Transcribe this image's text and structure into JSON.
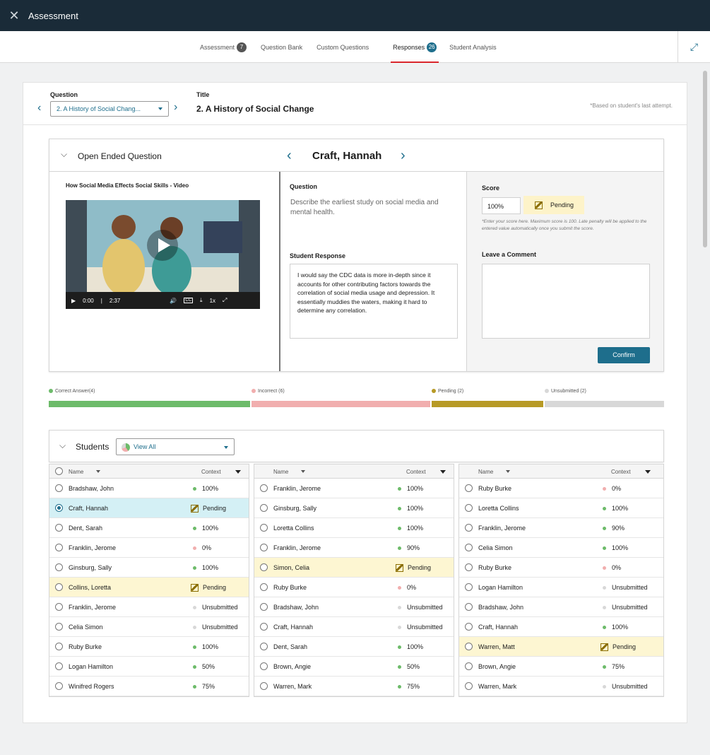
{
  "app": {
    "title": "Assessment",
    "close_icon": "close-icon"
  },
  "tabs": [
    {
      "label": "Assessment",
      "count": "7"
    },
    {
      "label": "Question Bank",
      "count": ""
    },
    {
      "label": "Custom Questions",
      "count": ""
    },
    {
      "label": "Responses",
      "count": "26",
      "active": true
    },
    {
      "label": "Student Analysis",
      "count": ""
    }
  ],
  "question": {
    "label": "Question",
    "selected": "2. A History of Social Chang...",
    "title_label": "Title",
    "title": "2. A History of Social Change",
    "note": "*Based on student's last attempt."
  },
  "open_ended": {
    "label": "Open Ended Question",
    "student": "Craft, Hannah"
  },
  "media": {
    "title": "How Social Media Effects Social Skills - Video",
    "time": "0:00",
    "duration": "2:37",
    "speed": "1x"
  },
  "prompt": {
    "label": "Question",
    "text": "Describe the earliest study on social media and mental health.",
    "response_label": "Student Response",
    "response": "I would say the CDC data is more in-depth since it accounts for other contributing factors towards the correlation of social media usage and depression. It essentially muddies the waters, making it hard to determine any correlation."
  },
  "score": {
    "label": "Score",
    "value": "100%",
    "status": "Pending",
    "hint": "*Enter your score here. Maximum score is 100. Late penalty will be applied to the entered value automatically once you submit the score.",
    "comment_label": "Leave a Comment",
    "confirm": "Confirm"
  },
  "progress": [
    {
      "label": "Correct Answer(4)",
      "color": "#6dbb6a"
    },
    {
      "label": "Incorrect (6)",
      "color": "#f1aeae"
    },
    {
      "label": "Pending (2)",
      "color": "#b79a26"
    },
    {
      "label": "Unsubmitted (2)",
      "color": "#d8d8d8"
    }
  ],
  "students": {
    "label": "Students",
    "filter": "View All",
    "name_header": "Name",
    "context_header": "Context",
    "columns": [
      [
        {
          "name": "Bradshaw, John",
          "status": "100%",
          "kind": "correct"
        },
        {
          "name": "Craft, Hannah",
          "status": "Pending",
          "kind": "pending",
          "selected": true
        },
        {
          "name": "Dent, Sarah",
          "status": "100%",
          "kind": "correct"
        },
        {
          "name": "Franklin, Jerome",
          "status": "0%",
          "kind": "incorrect"
        },
        {
          "name": "Ginsburg, Sally",
          "status": "100%",
          "kind": "correct"
        },
        {
          "name": "Collins, Loretta",
          "status": "Pending",
          "kind": "pending"
        },
        {
          "name": "Franklin, Jerome",
          "status": "Unsubmitted",
          "kind": "unsub"
        },
        {
          "name": "Celia Simon",
          "status": "Unsubmitted",
          "kind": "unsub"
        },
        {
          "name": "Ruby Burke",
          "status": "100%",
          "kind": "correct"
        },
        {
          "name": "Logan Hamilton",
          "status": "50%",
          "kind": "correct"
        },
        {
          "name": "Winifred Rogers",
          "status": "75%",
          "kind": "correct"
        }
      ],
      [
        {
          "name": "Franklin, Jerome",
          "status": "100%",
          "kind": "correct"
        },
        {
          "name": "Ginsburg, Sally",
          "status": "100%",
          "kind": "correct"
        },
        {
          "name": "Loretta Collins",
          "status": "100%",
          "kind": "correct"
        },
        {
          "name": "Franklin, Jerome",
          "status": "90%",
          "kind": "correct"
        },
        {
          "name": "Simon, Celia",
          "status": "Pending",
          "kind": "pending"
        },
        {
          "name": "Ruby Burke",
          "status": "0%",
          "kind": "incorrect"
        },
        {
          "name": "Bradshaw, John",
          "status": "Unsubmitted",
          "kind": "unsub"
        },
        {
          "name": "Craft, Hannah",
          "status": "Unsubmitted",
          "kind": "unsub"
        },
        {
          "name": "Dent, Sarah",
          "status": "100%",
          "kind": "correct"
        },
        {
          "name": "Brown, Angie",
          "status": "50%",
          "kind": "correct"
        },
        {
          "name": "Warren, Mark",
          "status": "75%",
          "kind": "correct"
        }
      ],
      [
        {
          "name": "Ruby Burke",
          "status": "0%",
          "kind": "incorrect"
        },
        {
          "name": "Loretta Collins",
          "status": "100%",
          "kind": "correct"
        },
        {
          "name": "Franklin, Jerome",
          "status": "90%",
          "kind": "correct"
        },
        {
          "name": "Celia Simon",
          "status": "100%",
          "kind": "correct"
        },
        {
          "name": "Ruby Burke",
          "status": "0%",
          "kind": "incorrect"
        },
        {
          "name": "Logan Hamilton",
          "status": "Unsubmitted",
          "kind": "unsub"
        },
        {
          "name": "Bradshaw, John",
          "status": "Unsubmitted",
          "kind": "unsub"
        },
        {
          "name": "Craft, Hannah",
          "status": "100%",
          "kind": "correct"
        },
        {
          "name": "Warren, Matt",
          "status": "Pending",
          "kind": "pending"
        },
        {
          "name": "Brown, Angie",
          "status": "75%",
          "kind": "correct"
        },
        {
          "name": "Warren, Mark",
          "status": "Unsubmitted",
          "kind": "unsub"
        }
      ]
    ]
  },
  "colors": {
    "correct": "#6dbb6a",
    "incorrect": "#f1aeae",
    "unsub": "#d8d8d8",
    "accent": "#1e6e8c"
  }
}
